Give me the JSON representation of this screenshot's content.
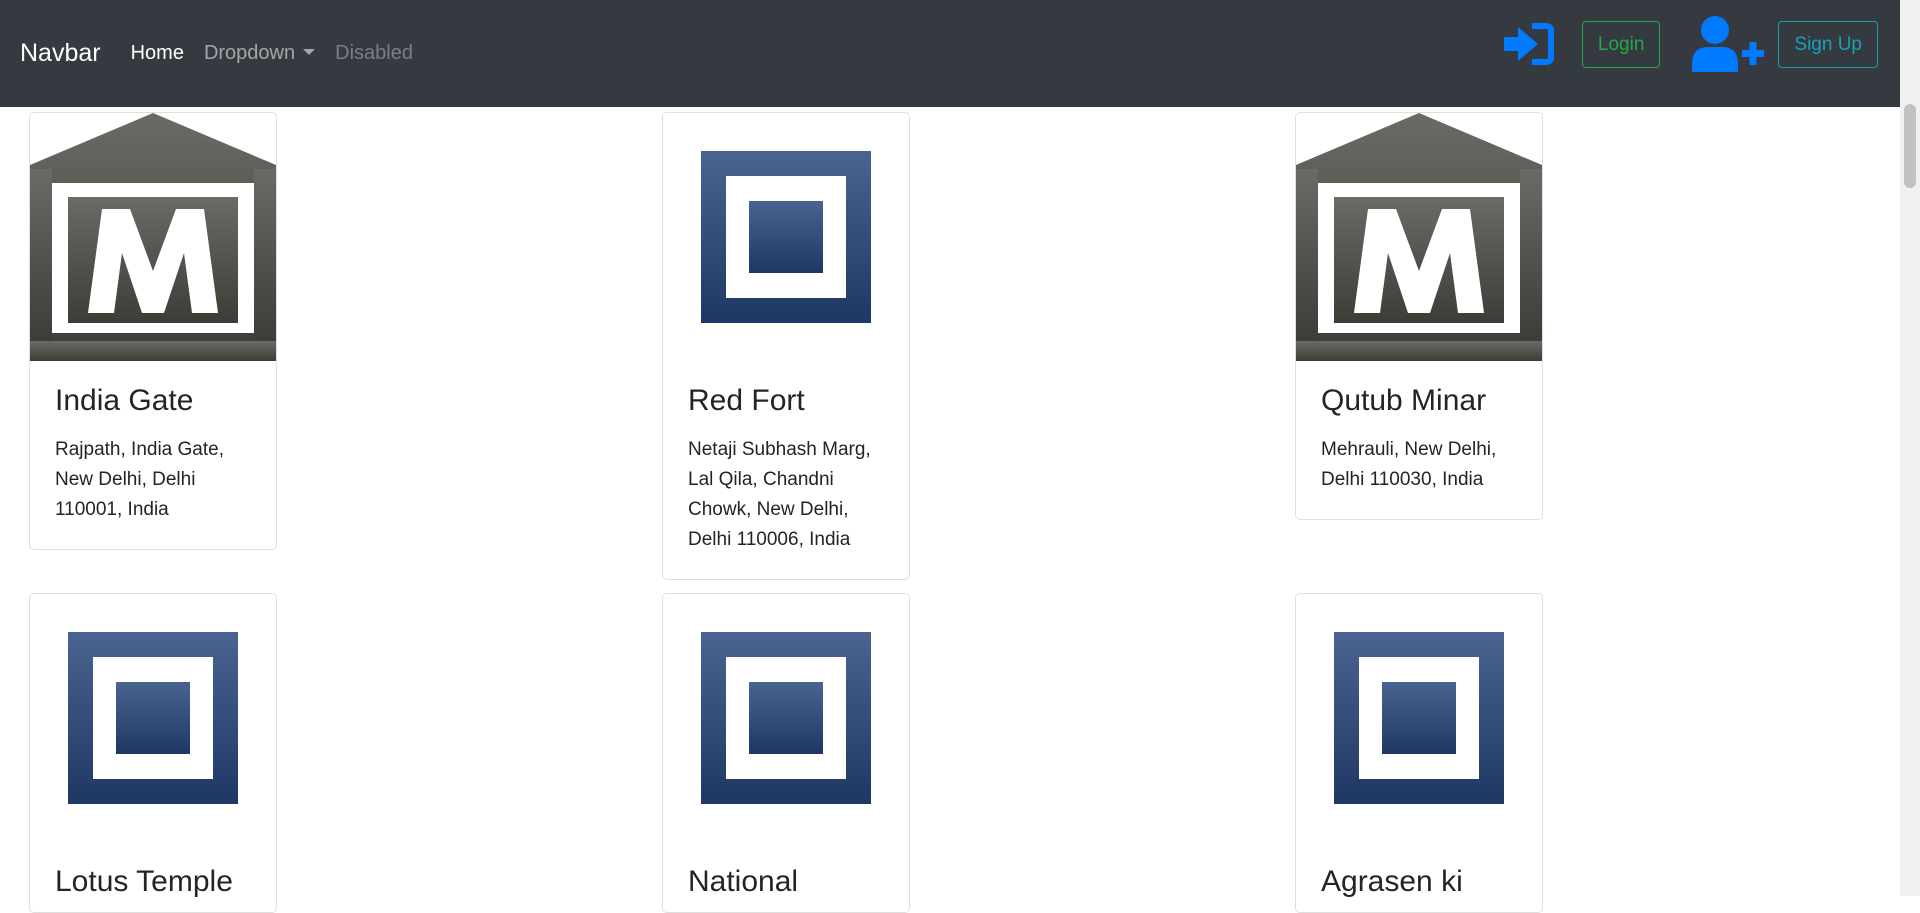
{
  "navbar": {
    "brand": "Navbar",
    "links": [
      {
        "label": "Home",
        "state": "active"
      },
      {
        "label": "Dropdown",
        "state": "normal"
      },
      {
        "label": "Disabled",
        "state": "disabled"
      }
    ],
    "login_icon": "sign-in-icon",
    "login_label": "Login",
    "signup_icon": "user-plus-icon",
    "signup_label": "Sign Up"
  },
  "colors": {
    "navbar_bg": "#343a40",
    "icon_blue": "#007bff",
    "login_green": "#28a745",
    "signup_teal": "#17a2b8",
    "museum_icon_gray": "#53564f",
    "monument_icon_blue": "#3c5482"
  },
  "cards": [
    {
      "title": "India Gate",
      "address": "Rajpath, India Gate, New Delhi, Delhi 110001, India",
      "image": "museum-icon"
    },
    {
      "title": "Red Fort",
      "address": "Netaji Subhash Marg, Lal Qila, Chandni Chowk, New Delhi, Delhi 110006, India",
      "image": "monument-icon"
    },
    {
      "title": "Qutub Minar",
      "address": "Mehrauli, New Delhi, Delhi 110030, India",
      "image": "museum-icon"
    },
    {
      "title": "Lotus Temple",
      "address": "",
      "image": "monument-icon"
    },
    {
      "title": "National",
      "address": "",
      "image": "monument-icon"
    },
    {
      "title": "Agrasen ki",
      "address": "",
      "image": "monument-icon"
    }
  ]
}
